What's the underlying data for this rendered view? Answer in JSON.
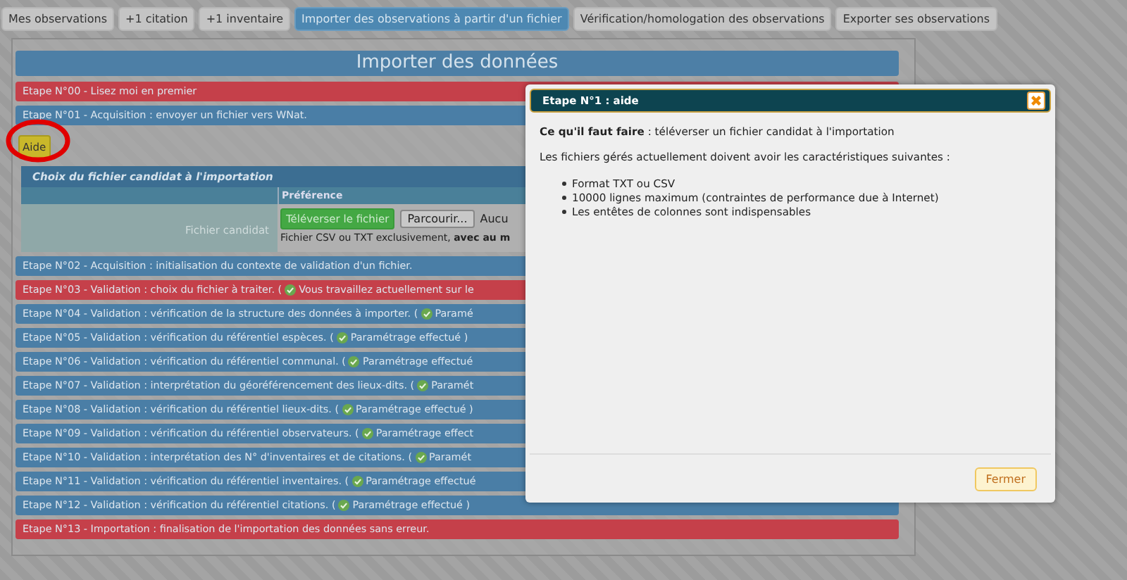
{
  "tabs": [
    {
      "label": "Mes observations",
      "selected": false
    },
    {
      "label": "+1 citation",
      "selected": false
    },
    {
      "label": "+1 inventaire",
      "selected": false
    },
    {
      "label": "Importer des observations à partir d'un fichier",
      "selected": true
    },
    {
      "label": "Vérification/homologation des observations",
      "selected": false
    },
    {
      "label": "Exporter ses observations",
      "selected": false
    }
  ],
  "panel": {
    "title": "Importer des données",
    "steps_before": [
      {
        "label": "Etape N°00 - Lisez moi en premier",
        "color": "#c5404a"
      },
      {
        "label": "Etape N°01 - Acquisition : envoyer un fichier vers WNat.",
        "color": "#4a7ea6"
      }
    ],
    "help_button": "Aide",
    "file_section": {
      "title": "Choix du fichier candidat à l'importation",
      "column_header": "Préférence",
      "row_label": "Fichier candidat",
      "upload_button": "Téléverser le fichier",
      "browse_button": "Parcourir...",
      "file_status": "Aucu",
      "note": "Fichier CSV ou TXT exclusivement, **avec au m**"
    },
    "steps": [
      {
        "label": "Etape N°02 - Acquisition : initialisation du contexte de validation d'un fichier.",
        "color": "#4a7ea6"
      },
      {
        "label": "Etape N°03 - Validation : choix du fichier à traiter. (",
        "color": "#c5404a",
        "status": "Vous travaillez actuellement sur le"
      },
      {
        "label": "Etape N°04 - Validation : vérification de la structure des données à importer. (",
        "color": "#4a7ea6",
        "status": "Paramé"
      },
      {
        "label": "Etape N°05 - Validation : vérification du référentiel espèces. (",
        "color": "#4a7ea6",
        "status": "Paramétrage effectué )"
      },
      {
        "label": "Etape N°06 - Validation : vérification du référentiel communal. (",
        "color": "#4a7ea6",
        "status": "Paramétrage effectué"
      },
      {
        "label": "Etape N°07 - Validation : interprétation du géoréférencement des lieux-dits. (",
        "color": "#4a7ea6",
        "status": "Paramét"
      },
      {
        "label": "Etape N°08 - Validation : vérification du référentiel lieux-dits. (",
        "color": "#4a7ea6",
        "status": "Paramétrage effectué )"
      },
      {
        "label": "Etape N°09 - Validation : vérification du référentiel observateurs. (",
        "color": "#4a7ea6",
        "status": "Paramétrage effect"
      },
      {
        "label": "Etape N°10 - Validation : interprétation des N° d'inventaires et de citations. (",
        "color": "#4a7ea6",
        "status": "Paramét"
      },
      {
        "label": "Etape N°11 - Validation : vérification du référentiel inventaires. (",
        "color": "#4a7ea6",
        "status": "Paramétrage effectué"
      },
      {
        "label": "Etape N°12 - Validation : vérification du référentiel citations. (",
        "color": "#4a7ea6",
        "status": "Paramétrage effectué )"
      },
      {
        "label": "Etape N°13 - Importation : finalisation de l'importation des données sans erreur.",
        "color": "#c5404a"
      }
    ]
  },
  "dialog": {
    "title": "Etape N°1 : aide",
    "paragraphs": [
      "**Ce qu'il faut faire** : téléverser un fichier candidat à l'importation",
      "Les fichiers gérés actuellement doivent avoir les caractéristiques suivantes :"
    ],
    "list": [
      "Format TXT ou CSV",
      "10000 lignes maximum (contraintes de performance due à Internet)",
      "Les entêtes de colonnes sont indispensables"
    ],
    "close_button": "Fermer"
  }
}
